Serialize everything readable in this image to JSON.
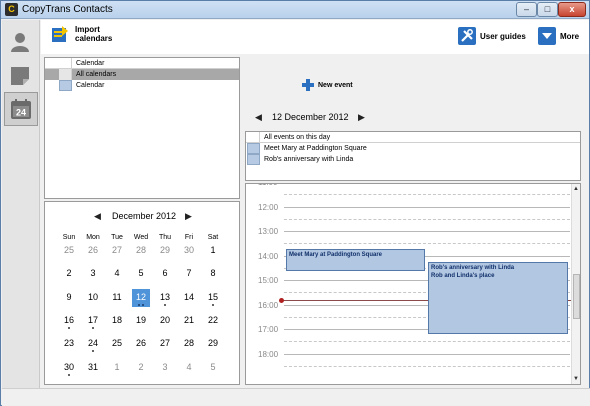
{
  "window": {
    "title": "CopyTrans Contacts",
    "app_icon": "C",
    "min_glyph": "–",
    "max_glyph": "□",
    "close_glyph": "x"
  },
  "leftnav": {
    "items": [
      {
        "icon": "contacts-icon",
        "active": false
      },
      {
        "icon": "notes-icon",
        "active": false
      },
      {
        "icon": "calendar-icon",
        "label": "24",
        "active": true
      }
    ]
  },
  "toolbar": {
    "import_line1": "Import",
    "import_line2": "calendars",
    "user_guides": "User guides",
    "more": "More"
  },
  "calendars": {
    "header": "Calendar",
    "rows": [
      {
        "label": "All calendars",
        "selected": true
      },
      {
        "label": "Calendar",
        "selected": false,
        "color": "#b6cbe3"
      }
    ]
  },
  "new_event": {
    "label": "New event"
  },
  "date_nav": {
    "prev": "◀",
    "next": "▶",
    "title": "12 December 2012"
  },
  "events_list": {
    "header": "All events on this day",
    "rows": [
      {
        "label": "Meet Mary at Paddington Square"
      },
      {
        "label": "Rob's anniversary with Linda"
      }
    ]
  },
  "mini_calendar": {
    "prev": "◀",
    "next": "▶",
    "title": "December 2012",
    "weekdays": [
      "Sun",
      "Mon",
      "Tue",
      "Wed",
      "Thu",
      "Fri",
      "Sat"
    ],
    "weeks": [
      [
        {
          "d": "25",
          "m": true
        },
        {
          "d": "26",
          "m": true
        },
        {
          "d": "27",
          "m": true
        },
        {
          "d": "28",
          "m": true
        },
        {
          "d": "29",
          "m": true
        },
        {
          "d": "30",
          "m": true
        },
        {
          "d": "1"
        }
      ],
      [
        {
          "d": "2"
        },
        {
          "d": "3"
        },
        {
          "d": "4"
        },
        {
          "d": "5"
        },
        {
          "d": "6"
        },
        {
          "d": "7"
        },
        {
          "d": "8"
        }
      ],
      [
        {
          "d": "9"
        },
        {
          "d": "10"
        },
        {
          "d": "11"
        },
        {
          "d": "12",
          "today": true,
          "dots": 2
        },
        {
          "d": "13",
          "dots": 1
        },
        {
          "d": "14"
        },
        {
          "d": "15",
          "dots": 1
        }
      ],
      [
        {
          "d": "16",
          "dots": 1
        },
        {
          "d": "17",
          "dots": 1
        },
        {
          "d": "18"
        },
        {
          "d": "19"
        },
        {
          "d": "20"
        },
        {
          "d": "21"
        },
        {
          "d": "22"
        }
      ],
      [
        {
          "d": "23"
        },
        {
          "d": "24",
          "dots": 1
        },
        {
          "d": "25"
        },
        {
          "d": "26"
        },
        {
          "d": "27"
        },
        {
          "d": "28"
        },
        {
          "d": "29"
        }
      ],
      [
        {
          "d": "30",
          "dots": 1
        },
        {
          "d": "31"
        },
        {
          "d": "1",
          "m": true
        },
        {
          "d": "2",
          "m": true
        },
        {
          "d": "3",
          "m": true
        },
        {
          "d": "4",
          "m": true
        },
        {
          "d": "5",
          "m": true
        }
      ]
    ]
  },
  "day_view": {
    "hours": [
      "11:00",
      "12:00",
      "13:00",
      "14:00",
      "15:00",
      "16:00",
      "17:00",
      "18:00"
    ],
    "now_time": "15:30",
    "events": [
      {
        "title": "Meet Mary at Paddington Square",
        "subtitle": "",
        "start": "14:30",
        "end": "15:30",
        "column": "left"
      },
      {
        "title": "Rob's anniversary with Linda",
        "subtitle": "Rob and Linda's place",
        "start": "15:00",
        "end": "17:00",
        "column": "right"
      }
    ],
    "scroll_up": "▲",
    "scroll_down": "▼"
  },
  "colors": {
    "accent": "#4f93d8",
    "event_fill": "#b2c7e2",
    "event_border": "#5478a8",
    "now_line": "#b02020"
  }
}
